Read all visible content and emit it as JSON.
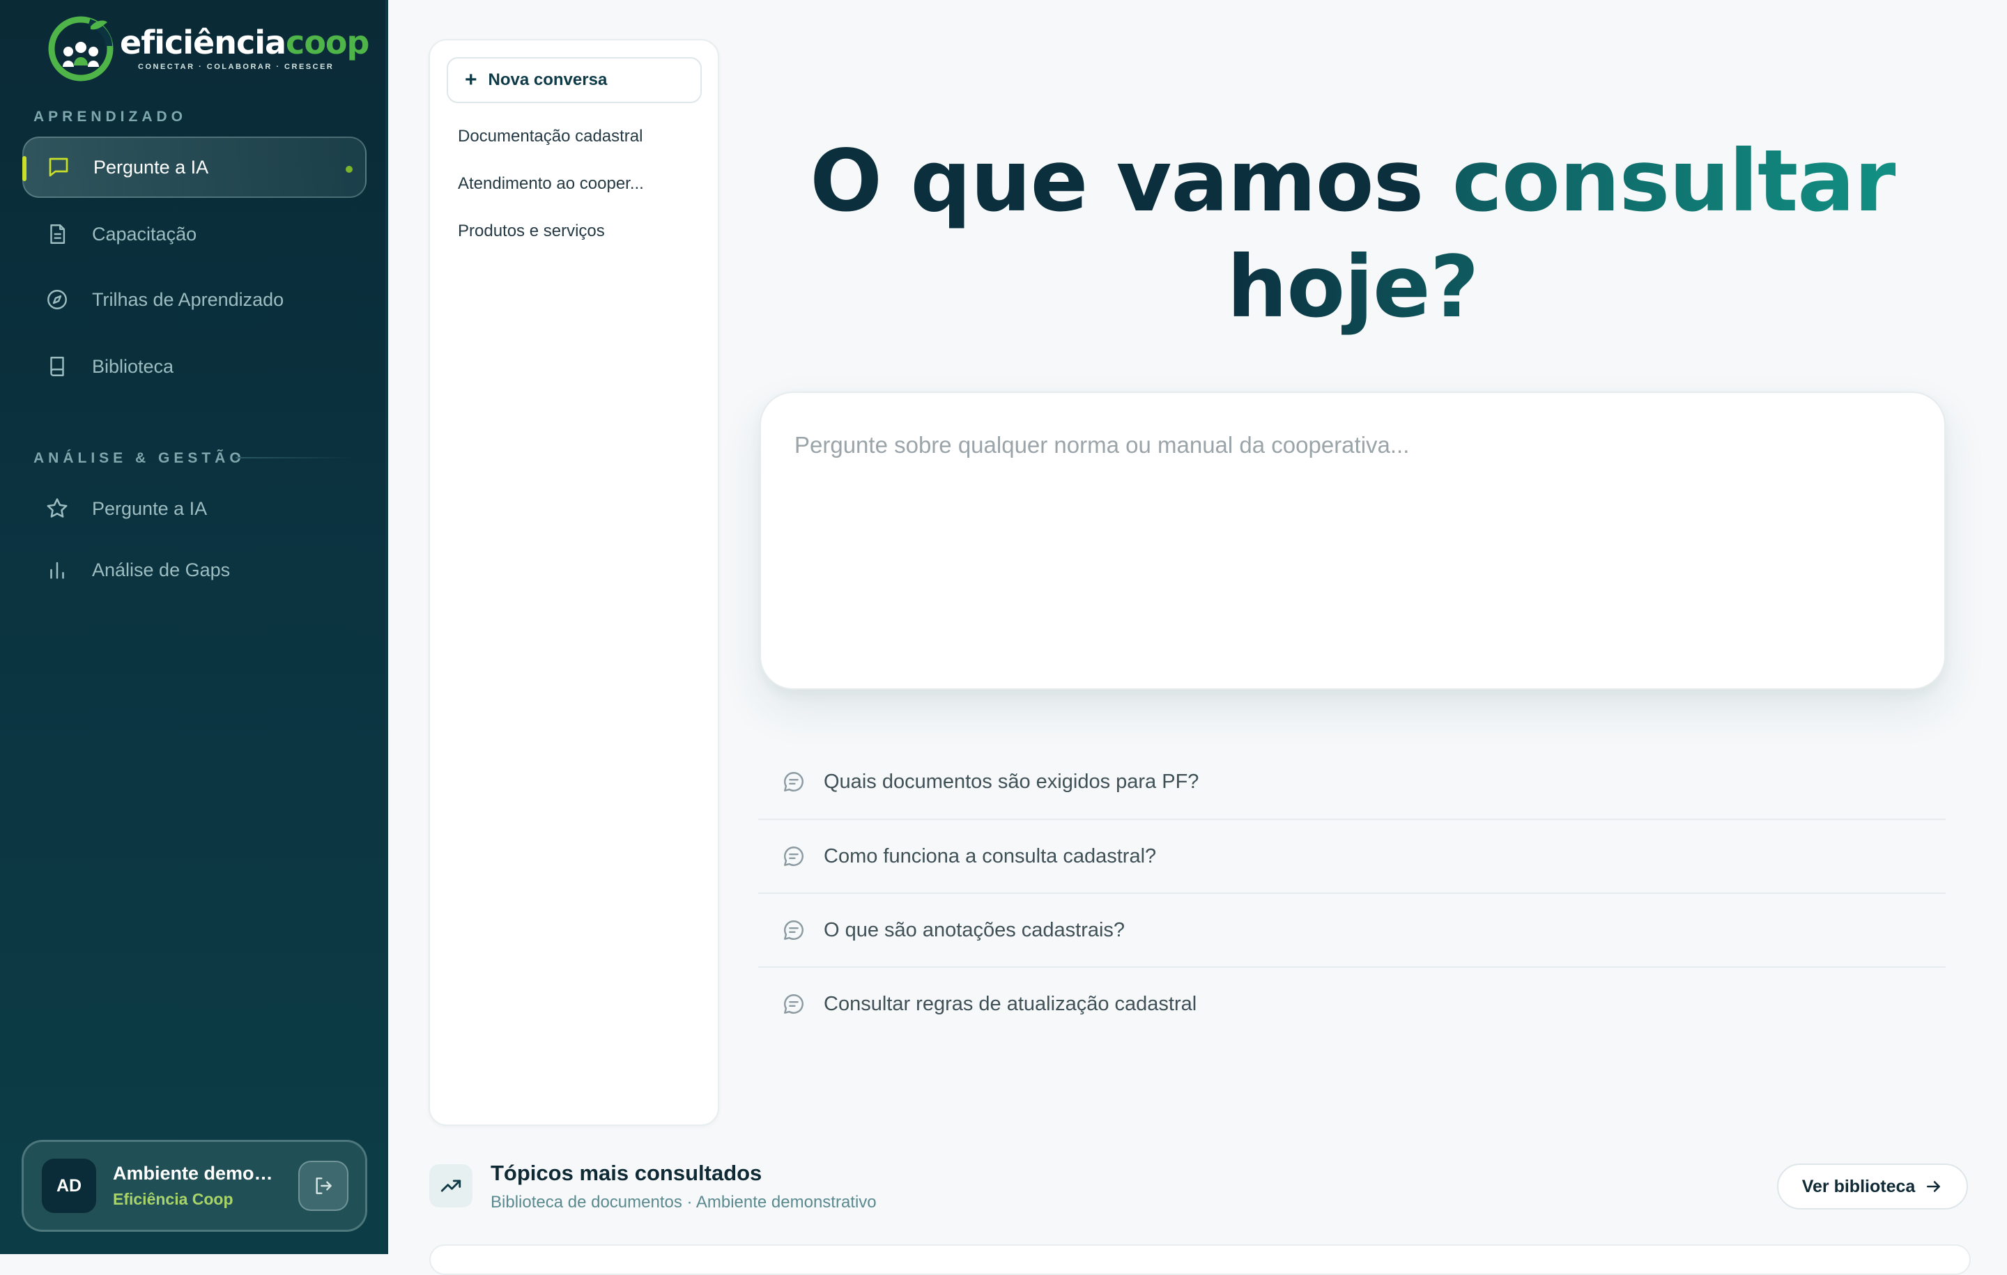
{
  "brand": {
    "word_part1": "eficiência",
    "word_part2": "coop",
    "tagline": "CONECTAR · COLABORAR · CRESCER"
  },
  "sidebar": {
    "section_learning": "APRENDIZADO",
    "learning_items": [
      {
        "label": "Pergunte a IA",
        "icon": "chat-bubble-icon",
        "active": true
      },
      {
        "label": "Capacitação",
        "icon": "document-icon"
      },
      {
        "label": "Trilhas de Aprendizado",
        "icon": "compass-icon"
      },
      {
        "label": "Biblioteca",
        "icon": "book-icon"
      }
    ],
    "section_analysis": "ANÁLISE & GESTÃO",
    "analysis_items": [
      {
        "label": "Pergunte a IA",
        "icon": "star-icon"
      },
      {
        "label": "Análise de Gaps",
        "icon": "bar-chart-icon"
      }
    ],
    "user": {
      "initials": "AD",
      "name": "Ambiente demon...",
      "org": "Eficiência Coop"
    }
  },
  "conversations": {
    "new_label": "Nova conversa",
    "items": [
      "Documentação cadastral",
      "Atendimento ao cooper...",
      "Produtos e serviços"
    ]
  },
  "main": {
    "headline_part1": "O que vamos",
    "headline_accent": "consultar",
    "headline_part2": "hoje?",
    "query_placeholder": "Pergunte sobre qualquer norma ou manual da cooperativa...",
    "suggestions": [
      "Quais documentos são exigidos para PF?",
      "Como funciona a consulta cadastral?",
      "O que são anotações cadastrais?",
      "Consultar regras de atualização cadastral"
    ]
  },
  "topics": {
    "title": "Tópicos mais consultados",
    "subtitle": "Biblioteca de documentos · Ambiente demonstrativo",
    "button_label": "Ver biblioteca"
  },
  "colors": {
    "sidebar_bg": "#0b3340",
    "brand_green": "#4fb548",
    "accent_teal": "#129083",
    "active_bar": "#c9e02a"
  }
}
